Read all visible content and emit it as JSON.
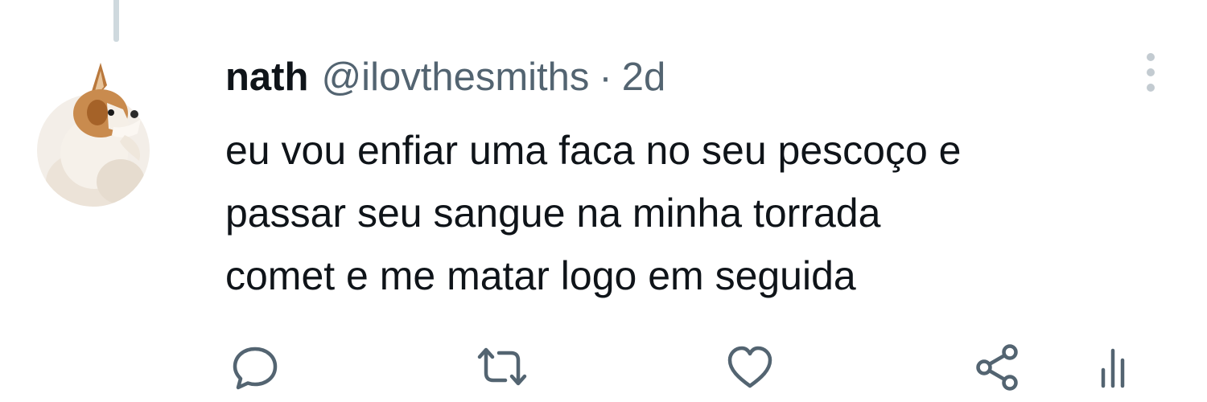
{
  "tweet": {
    "display_name": "nath",
    "handle": "@ilovthesmiths",
    "separator": "·",
    "time": "2d",
    "text_lines": [
      "eu vou enfiar uma faca no seu pescoço e",
      "passar seu sangue na minha torrada",
      "comet e me matar logo em seguida"
    ]
  },
  "icons": {
    "more": "more-vertical-icon",
    "reply": "reply-icon",
    "retweet": "retweet-icon",
    "like": "heart-icon",
    "share": "share-icon",
    "analytics": "analytics-icon"
  },
  "colors": {
    "text": "#0f1419",
    "secondary": "#536471",
    "line": "#cfd9de"
  }
}
